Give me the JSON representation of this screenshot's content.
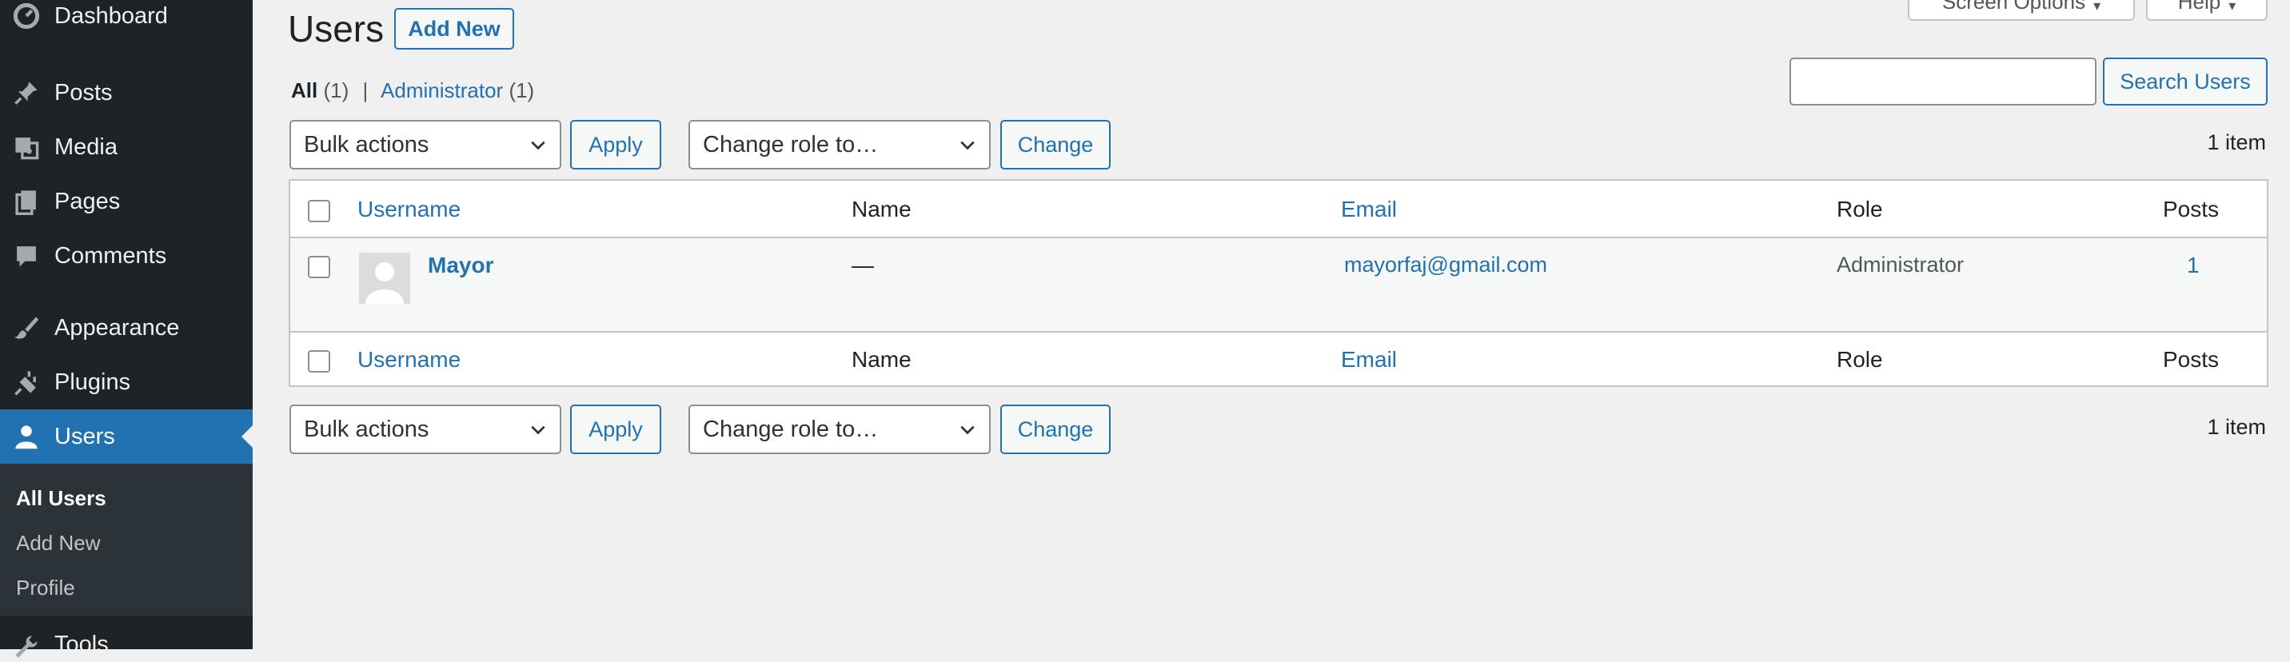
{
  "sidebar": {
    "items": [
      {
        "label": "Dashboard",
        "icon": "dashboard-icon"
      },
      {
        "label": "Posts",
        "icon": "pin-icon"
      },
      {
        "label": "Media",
        "icon": "media-icon"
      },
      {
        "label": "Pages",
        "icon": "pages-icon"
      },
      {
        "label": "Comments",
        "icon": "comment-icon"
      },
      {
        "label": "Appearance",
        "icon": "brush-icon"
      },
      {
        "label": "Plugins",
        "icon": "plugin-icon"
      },
      {
        "label": "Users",
        "icon": "user-icon"
      },
      {
        "label": "Tools",
        "icon": "wrench-icon"
      }
    ],
    "submenu": [
      "All Users",
      "Add New",
      "Profile"
    ],
    "active_color": "#2271b1"
  },
  "header": {
    "title": "Users",
    "add_new": "Add New",
    "screen_options": "Screen Options",
    "help": "Help"
  },
  "filters": {
    "all_label": "All",
    "all_count": "(1)",
    "separator": "|",
    "admin_label": "Administrator",
    "admin_count": "(1)"
  },
  "search": {
    "value": "",
    "button": "Search Users"
  },
  "tablenav": {
    "bulk_actions": "Bulk actions",
    "apply": "Apply",
    "change_role": "Change role to…",
    "change": "Change",
    "item_count": "1 item"
  },
  "table": {
    "columns": [
      "Username",
      "Name",
      "Email",
      "Role",
      "Posts"
    ],
    "rows": [
      {
        "username": "Mayor",
        "name": "—",
        "email": "mayorfaj@gmail.com",
        "role": "Administrator",
        "posts": "1"
      }
    ]
  }
}
